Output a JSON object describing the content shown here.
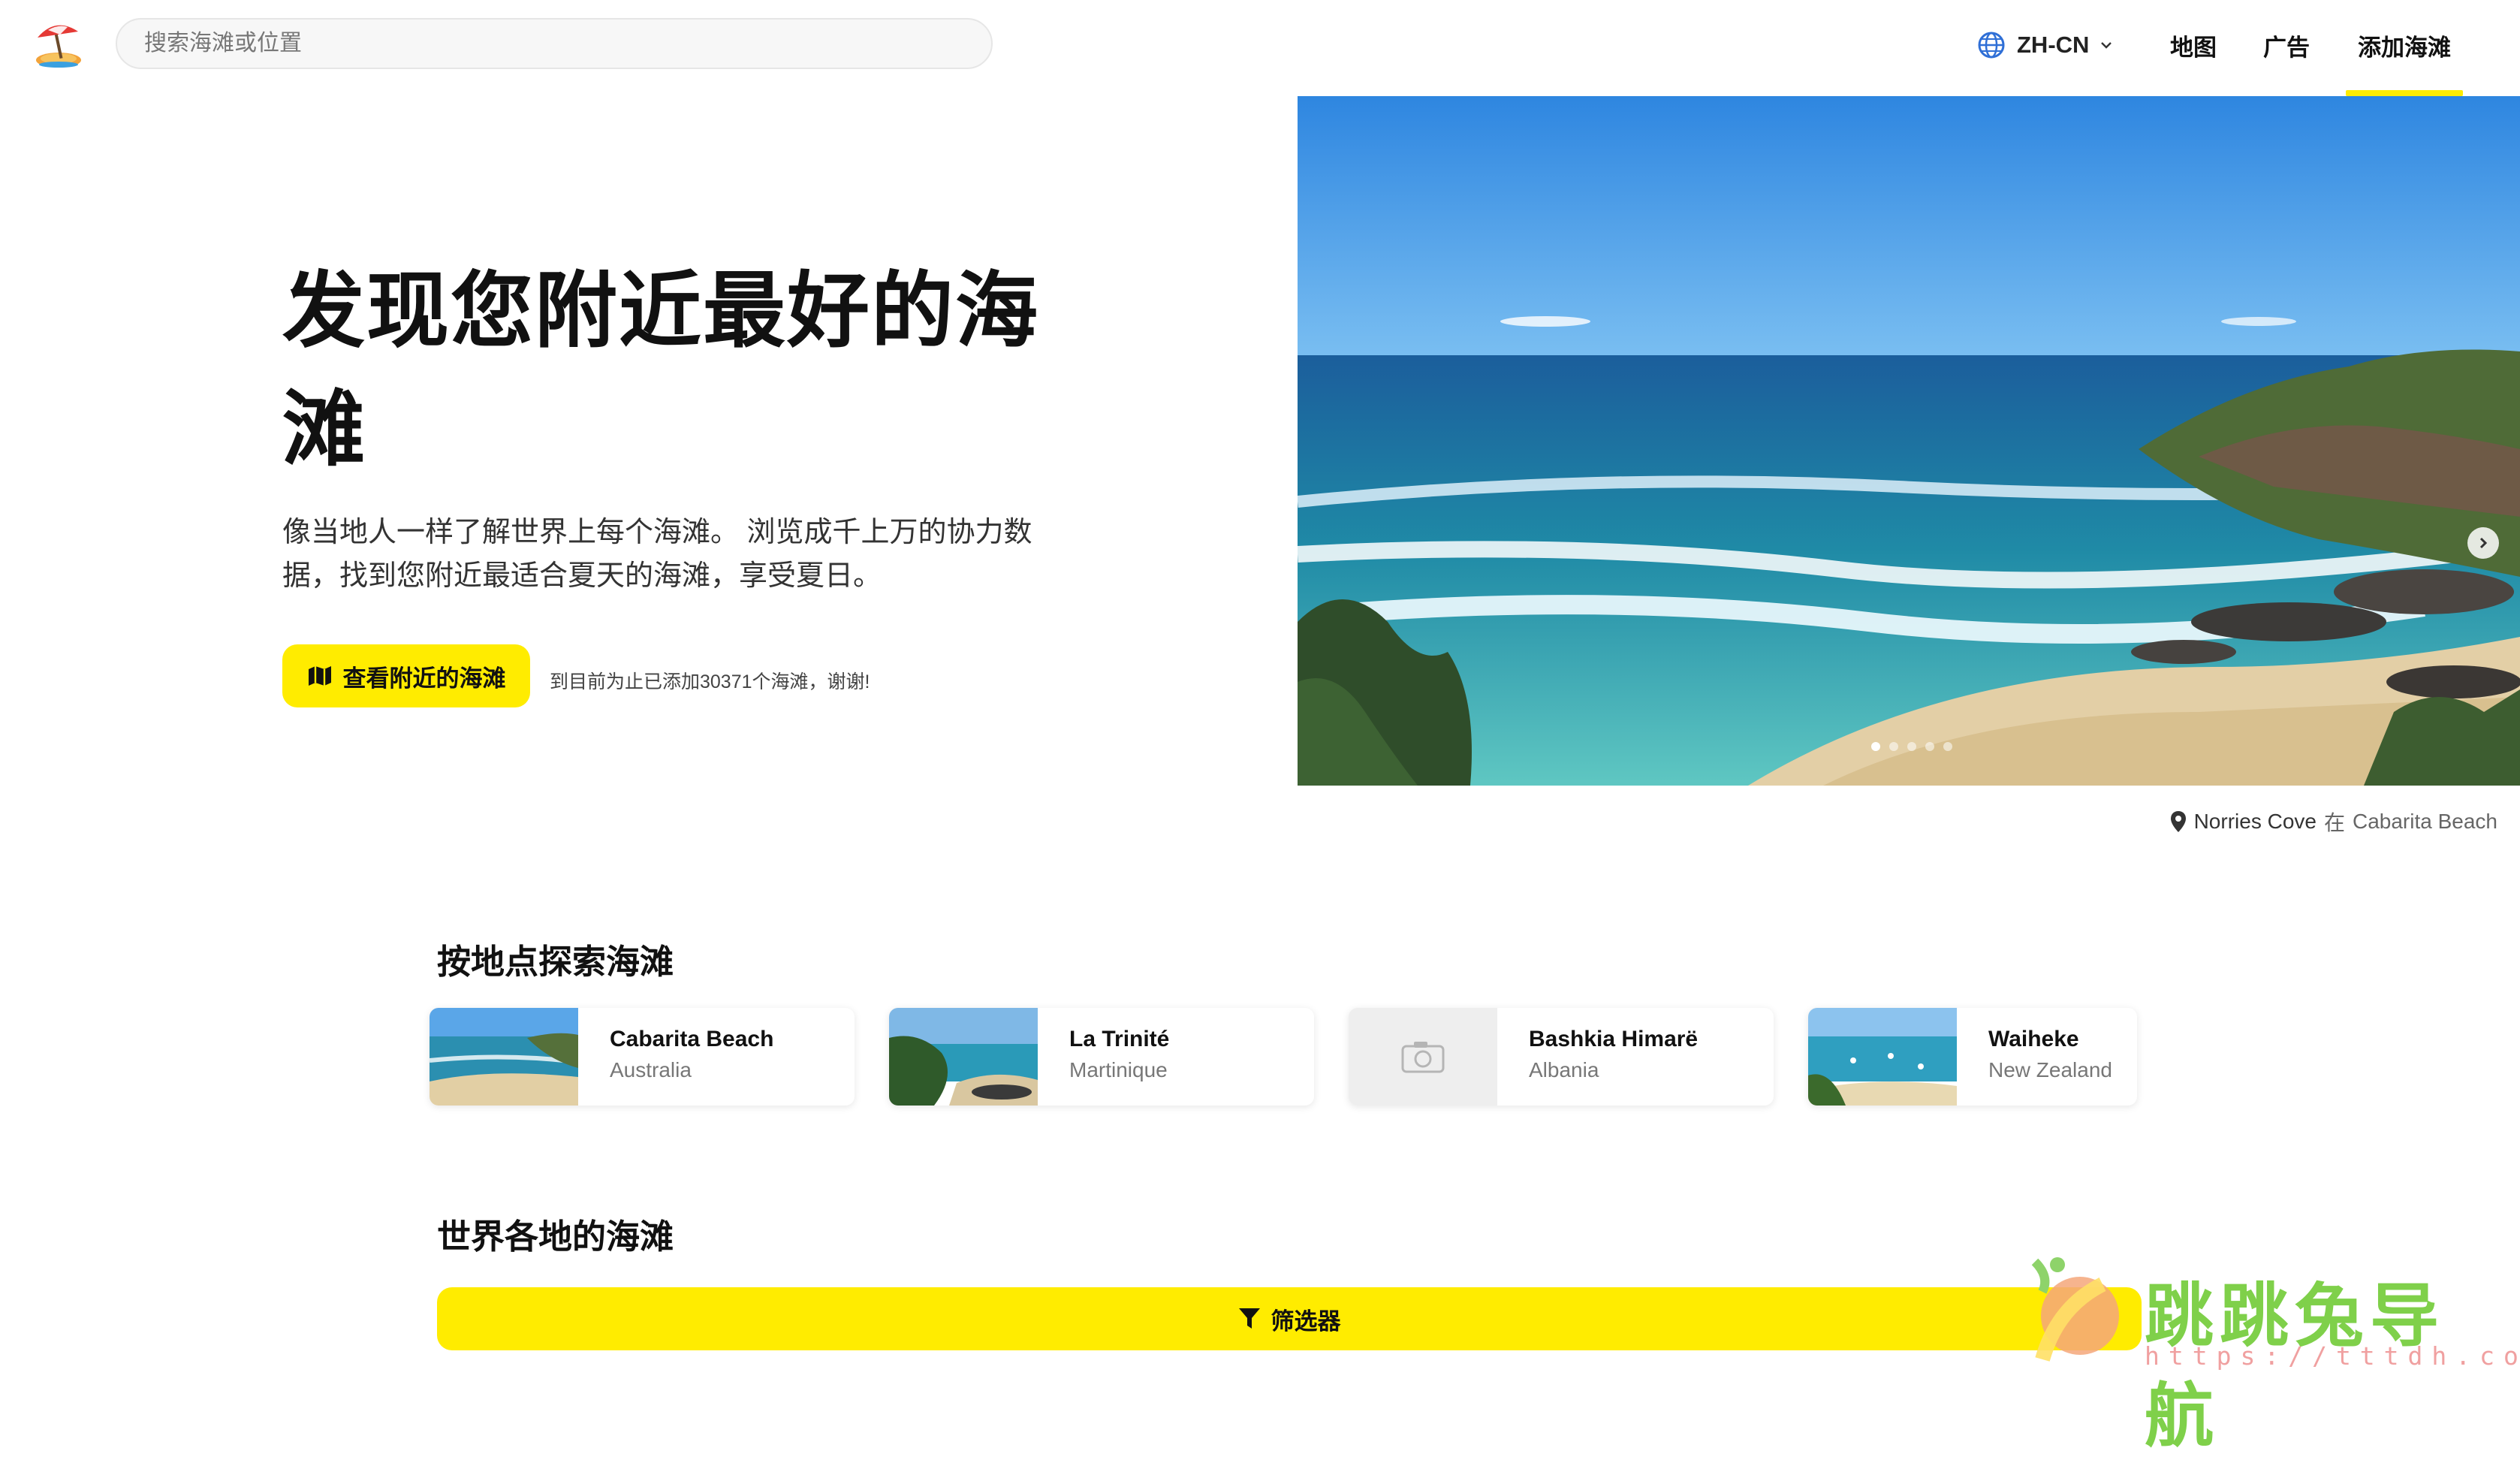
{
  "header": {
    "search_placeholder": "搜索海滩或位置",
    "language": "ZH-CN",
    "nav": {
      "map": "地图",
      "ads": "广告",
      "add_beach": "添加海滩"
    },
    "active_nav": "add_beach"
  },
  "hero": {
    "title": "发现您附近最好的海滩",
    "subtitle": "像当地人一样了解世界上每个海滩。 浏览成千上万的协力数据，找到您附近最适合夏天的海滩，享受夏日。",
    "cta_label": "查看附近的海滩",
    "beach_count_text": "到目前为止已添加30371个海滩，谢谢!",
    "carousel": {
      "total_slides": 5,
      "active_slide": 1
    },
    "photo_caption": {
      "place": "Norries Cove",
      "connector": "在",
      "beach": "Cabarita Beach"
    }
  },
  "sections": {
    "by_location": {
      "title": "按地点探索海滩",
      "cards": [
        {
          "name": "Cabarita Beach",
          "country": "Australia"
        },
        {
          "name": "La Trinité",
          "country": "Martinique"
        },
        {
          "name": "Bashkia Himarë",
          "country": "Albania"
        },
        {
          "name": "Waiheke",
          "country": "New Zealand"
        }
      ]
    },
    "worldwide": {
      "title": "世界各地的海滩",
      "filter_label": "筛选器"
    }
  },
  "watermark": {
    "text": "跳跳兔导航",
    "url": "https://tttdh.com"
  },
  "colors": {
    "accent_yellow": "#ffec00",
    "text": "#111111",
    "muted": "#777777"
  },
  "icons": {
    "logo": "beach-umbrella-icon",
    "language": "globe-icon",
    "dropdown": "chevron-down-icon",
    "cta": "map-icon",
    "caption": "location-pin-icon",
    "carousel": "chevron-right-icon",
    "filter": "funnel-icon"
  }
}
